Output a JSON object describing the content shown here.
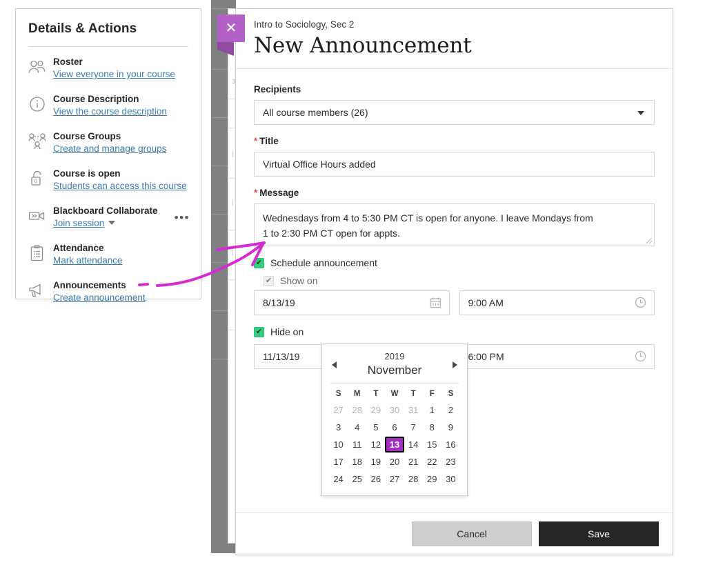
{
  "sidebar": {
    "title": "Details & Actions",
    "items": [
      {
        "icon": "roster-people-icon",
        "label": "Roster",
        "link": "View everyone in your course"
      },
      {
        "icon": "info-circle-icon",
        "label": "Course Description",
        "link": "View the course description"
      },
      {
        "icon": "course-groups-icon",
        "label": "Course Groups",
        "link": "Create and manage groups"
      },
      {
        "icon": "unlocked-padlock-icon",
        "label": "Course is open",
        "link": "Students can access this course"
      },
      {
        "icon": "video-camera-icon",
        "label": "Blackboard Collaborate",
        "link": "Join session",
        "has_caret": true,
        "has_kebab": true,
        "kebab": "•••"
      },
      {
        "icon": "clipboard-icon",
        "label": "Attendance",
        "link": "Mark attendance"
      },
      {
        "icon": "megaphone-icon",
        "label": "Announcements",
        "link": "Create announcement"
      }
    ]
  },
  "modal": {
    "close_label": "✕",
    "eyebrow": "Intro to Sociology, Sec 2",
    "title": "New Announcement",
    "recipients": {
      "label": "Recipients",
      "value": "All course members (26)"
    },
    "title_field": {
      "star": "*",
      "label": "Title",
      "value": "Virtual Office Hours added"
    },
    "message_field": {
      "star": "*",
      "label": "Message",
      "line1": "Wednesdays from 4 to 5:30 PM CT is open for anyone. I leave Mondays from",
      "line2": "1 to 2:30 PM CT open for appts."
    },
    "schedule_checkbox": {
      "label": "Schedule announcement",
      "checked": true
    },
    "show_on": {
      "label": "Show on",
      "checked": true,
      "disabled": true,
      "date": "8/13/19",
      "time": "9:00 AM"
    },
    "hide_on": {
      "label": "Hide on",
      "checked": true,
      "disabled": false,
      "date": "11/13/19",
      "time": "6:00 PM"
    },
    "footer": {
      "cancel": "Cancel",
      "save": "Save"
    }
  },
  "calendar": {
    "year": "2019",
    "month": "November",
    "prev_icon": "caret-left-icon",
    "next_icon": "caret-right-icon",
    "dow": [
      "S",
      "M",
      "T",
      "W",
      "T",
      "F",
      "S"
    ],
    "weeks": [
      [
        {
          "d": "27",
          "o": true
        },
        {
          "d": "28",
          "o": true
        },
        {
          "d": "29",
          "o": true
        },
        {
          "d": "30",
          "o": true
        },
        {
          "d": "31",
          "o": true
        },
        {
          "d": "1"
        },
        {
          "d": "2"
        }
      ],
      [
        {
          "d": "3"
        },
        {
          "d": "4"
        },
        {
          "d": "5"
        },
        {
          "d": "6"
        },
        {
          "d": "7"
        },
        {
          "d": "8"
        },
        {
          "d": "9"
        }
      ],
      [
        {
          "d": "10"
        },
        {
          "d": "11"
        },
        {
          "d": "12"
        },
        {
          "d": "13",
          "sel": true
        },
        {
          "d": "14"
        },
        {
          "d": "15"
        },
        {
          "d": "16"
        }
      ],
      [
        {
          "d": "17"
        },
        {
          "d": "18"
        },
        {
          "d": "19"
        },
        {
          "d": "20"
        },
        {
          "d": "21"
        },
        {
          "d": "22"
        },
        {
          "d": "23"
        }
      ],
      [
        {
          "d": "24"
        },
        {
          "d": "25"
        },
        {
          "d": "26"
        },
        {
          "d": "27"
        },
        {
          "d": "28"
        },
        {
          "d": "29"
        },
        {
          "d": "30"
        }
      ]
    ]
  },
  "colors": {
    "accent_purple": "#b261c6",
    "accent_purple_dark": "#8e4ba0",
    "selected_day": "#a12ebd",
    "checkbox_green": "#35d07f",
    "link_blue": "#3d7dad",
    "required_red": "#d9534f",
    "annotation_magenta": "#d42bd4",
    "save_black": "#262626",
    "cancel_grey": "#cecece"
  }
}
